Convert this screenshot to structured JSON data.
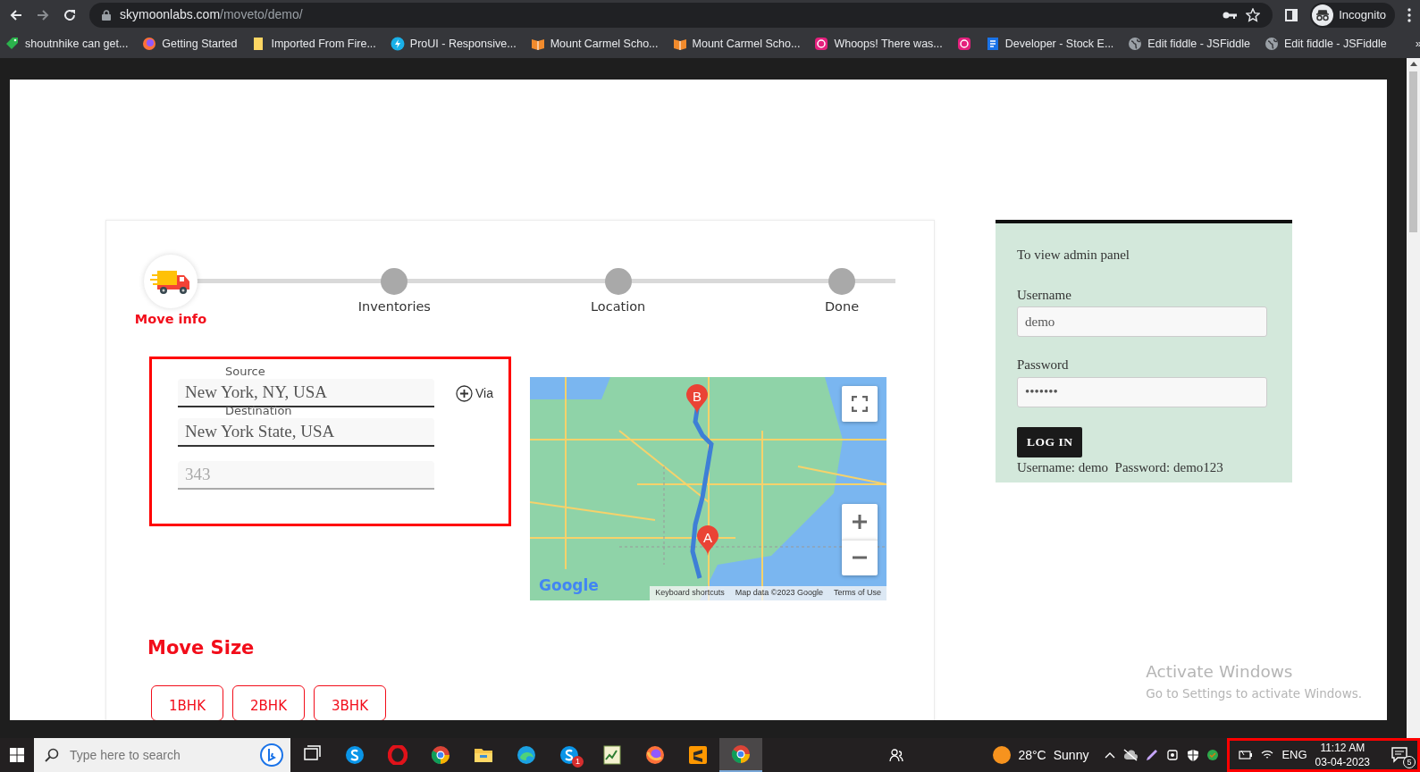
{
  "browser": {
    "host": "skymoonlabs.com",
    "path": "/moveto/demo/",
    "profile": "Incognito"
  },
  "bookmarks": [
    {
      "kind": "tag",
      "label": "shoutnhike can get..."
    },
    {
      "kind": "firefox",
      "label": "Getting Started"
    },
    {
      "kind": "folder",
      "label": "Imported From Fire..."
    },
    {
      "kind": "bolt",
      "label": "ProUI - Responsive..."
    },
    {
      "kind": "book",
      "label": "Mount Carmel Scho..."
    },
    {
      "kind": "book",
      "label": "Mount Carmel Scho..."
    },
    {
      "kind": "whoops",
      "label": "Whoops! There was..."
    },
    {
      "kind": "whoops"
    },
    {
      "kind": "doc",
      "label": "Developer - Stock E..."
    },
    {
      "kind": "globe",
      "label": "Edit fiddle - JSFiddle"
    },
    {
      "kind": "globe",
      "label": "Edit fiddle - JSFiddle"
    }
  ],
  "bookmarks_more": "»",
  "stepper": {
    "steps": [
      {
        "label": "Move info",
        "selected": true
      },
      {
        "label": "Inventories",
        "selected": false
      },
      {
        "label": "Location",
        "selected": false
      },
      {
        "label": "Done",
        "selected": false
      }
    ]
  },
  "route_form": {
    "highlighted": true,
    "source_label": "Source",
    "source_value": "New York, NY, USA",
    "destination_label": "Destination",
    "destination_value": "New York State, USA",
    "distance_placeholder": "343",
    "via": "Via"
  },
  "map": {
    "markers": [
      {
        "label": "B"
      },
      {
        "label": "A"
      }
    ],
    "logo": "Google",
    "attribution": [
      "Keyboard shortcuts",
      "Map data ©2023 Google",
      "Terms of Use"
    ]
  },
  "move_size": {
    "title": "Move Size",
    "options": [
      {
        "label": "1BHK",
        "selected": false
      },
      {
        "label": "2BHK",
        "selected": false
      },
      {
        "label": "3BHK",
        "selected": false
      }
    ]
  },
  "login": {
    "intro": "To view admin panel",
    "username_label": "Username",
    "username_value": "demo",
    "password_label": "Password",
    "password_value": "•••••••",
    "button": "LOG IN",
    "hint": "Username: demo  Password: demo123"
  },
  "os_watermark": {
    "title": "Activate Windows",
    "subtitle": "Go to Settings to activate Windows."
  },
  "taskbar": {
    "search_placeholder": "Type here to search",
    "apps": [
      {
        "kind": "taskview",
        "selected": false
      },
      {
        "kind": "skype",
        "selected": false
      },
      {
        "kind": "opera",
        "selected": false
      },
      {
        "kind": "chrome",
        "selected": false
      },
      {
        "kind": "files",
        "selected": false
      },
      {
        "kind": "edge",
        "selected": false
      },
      {
        "kind": "skype",
        "selected": false,
        "badge": "1"
      },
      {
        "kind": "sheet",
        "selected": false
      },
      {
        "kind": "firefox",
        "selected": false
      },
      {
        "kind": "sublime",
        "selected": false
      },
      {
        "kind": "chrome",
        "selected": true
      }
    ],
    "weather": {
      "temperature": "28°C",
      "condition": "Sunny"
    },
    "tray": {
      "highlighted": true,
      "language": "ENG",
      "time": "11:12 AM",
      "date": "03-04-2023",
      "notifications": "5"
    }
  }
}
